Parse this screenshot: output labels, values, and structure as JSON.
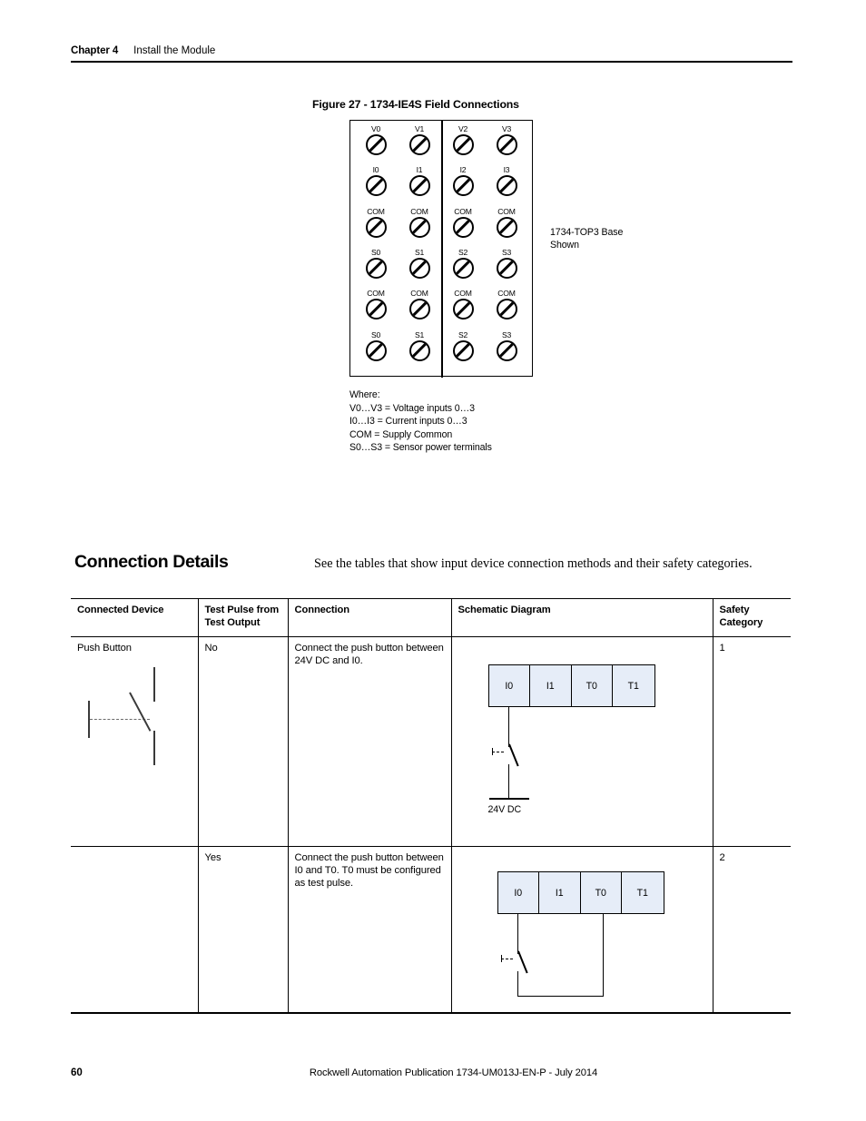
{
  "header": {
    "chapter": "Chapter 4",
    "chapter_title": "Install the Module"
  },
  "figure": {
    "caption": "Figure 27 - 1734-IE4S Field Connections",
    "base_note": "1734-TOP3 Base\nShown",
    "terminals": [
      [
        "V0",
        "V1",
        "V2",
        "V3"
      ],
      [
        "I0",
        "I1",
        "I2",
        "I3"
      ],
      [
        "COM",
        "COM",
        "COM",
        "COM"
      ],
      [
        "S0",
        "S1",
        "S2",
        "S3"
      ],
      [
        "COM",
        "COM",
        "COM",
        "COM"
      ],
      [
        "S0",
        "S1",
        "S2",
        "S3"
      ]
    ],
    "where_title": "Where:",
    "where_lines": [
      "V0…V3 = Voltage inputs 0…3",
      "I0…I3 = Current inputs 0…3",
      "COM = Supply Common",
      "S0…S3 = Sensor power terminals"
    ]
  },
  "section": {
    "heading": "Connection Details",
    "intro": "See the tables that show input device connection methods and their safety categories."
  },
  "table": {
    "headers": [
      "Connected Device",
      "Test Pulse from\nTest Output",
      "Connection",
      "Schematic Diagram",
      "Safety\nCategory"
    ],
    "rows": [
      {
        "device": "Push Button",
        "test_pulse": "No",
        "connection": "Connect the push button between 24V DC and I0.",
        "safety_category": "1",
        "schematic": {
          "terminals": [
            "I0",
            "I1",
            "T0",
            "T1"
          ],
          "rail_label": "24V DC"
        }
      },
      {
        "device": "",
        "test_pulse": "Yes",
        "connection": "Connect the push button between I0 and T0. T0 must be configured as test pulse.",
        "safety_category": "2",
        "schematic": {
          "terminals": [
            "I0",
            "I1",
            "T0",
            "T1"
          ],
          "rail_label": ""
        }
      }
    ]
  },
  "footer": {
    "page_number": "60",
    "publication": "Rockwell Automation Publication 1734-UM013J-EN-P - July 2014"
  },
  "colors": {
    "terminal_fill": "#e6edf8",
    "rule": "#000000"
  }
}
